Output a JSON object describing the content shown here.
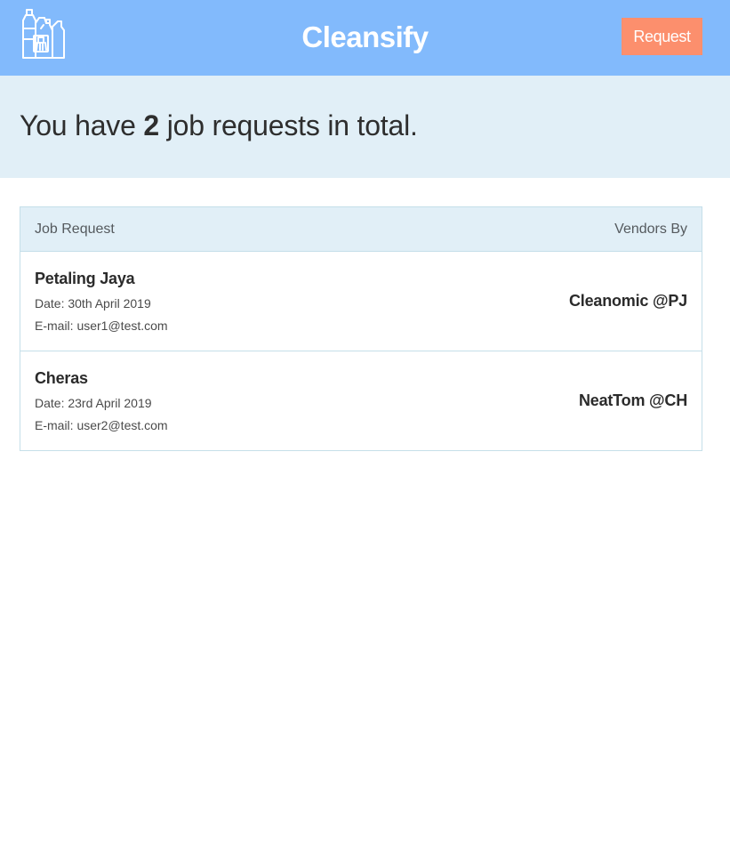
{
  "header": {
    "brand": "Cleansify",
    "logo_icon": "cleaning-supplies-icon",
    "request_label": "Request",
    "bar_color": "#82bafc",
    "button_color": "#fc8f6d"
  },
  "summary": {
    "prefix": "You have",
    "count": "2",
    "suffix": "job requests in total."
  },
  "table": {
    "col_left": "Job Request",
    "col_right": "Vendors By",
    "rows": [
      {
        "location": "Petaling Jaya",
        "date": "Date: 30th April 2019",
        "email": "E-mail: user1@test.com",
        "vendor": "Cleanomic @PJ"
      },
      {
        "location": "Cheras",
        "date": "Date: 23rd April 2019",
        "email": "E-mail: user2@test.com",
        "vendor": "NeatTom @CH"
      }
    ]
  }
}
